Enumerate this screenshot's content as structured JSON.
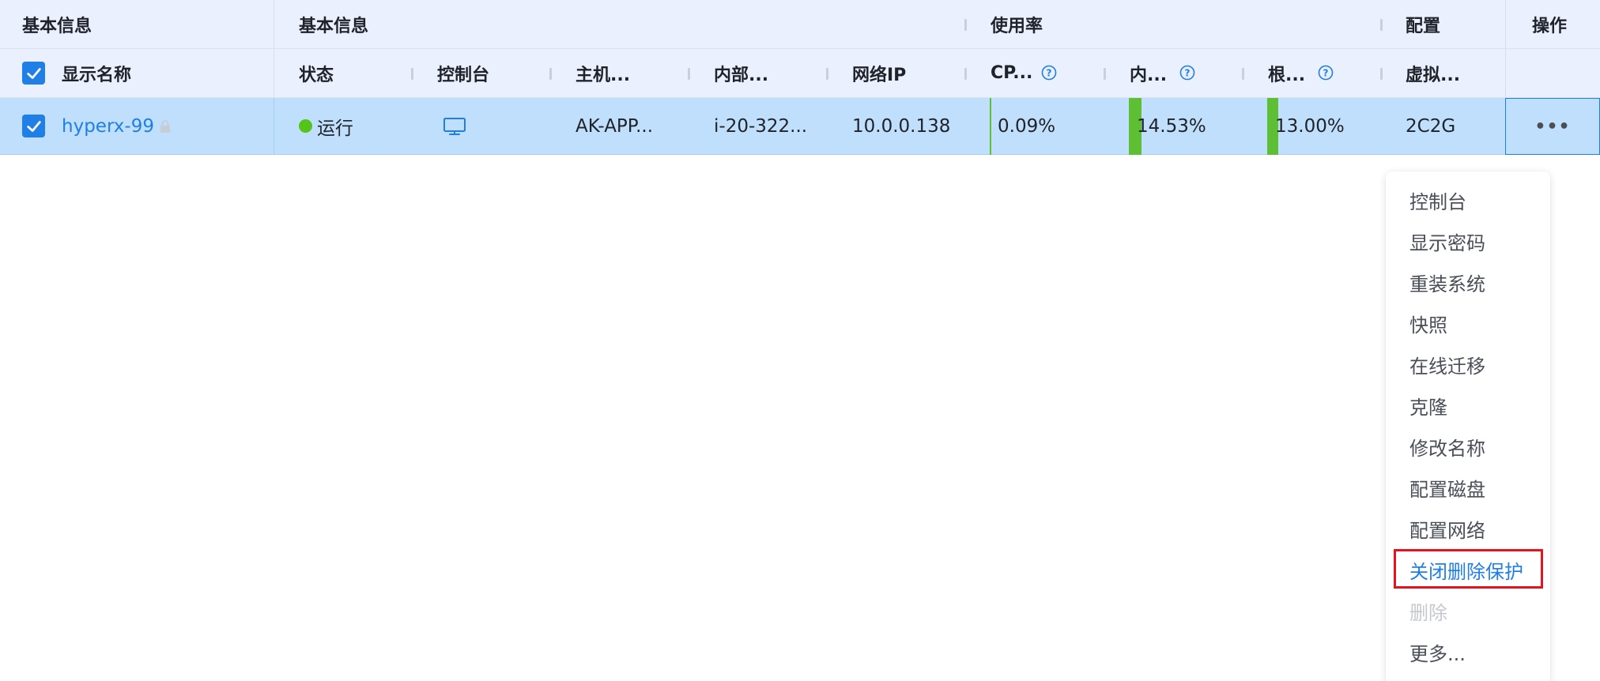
{
  "header_groups": {
    "basic_info_1": "基本信息",
    "basic_info_2": "基本信息",
    "usage": "使用率",
    "config": "配置",
    "operations": "操作"
  },
  "columns": {
    "display_name": "显示名称",
    "status": "状态",
    "console": "控制台",
    "host": "主机...",
    "internal": "内部...",
    "network_ip": "网络IP",
    "cpu": "CP...",
    "memory": "内...",
    "root": "根...",
    "virtual": "虚拟..."
  },
  "row": {
    "name": "hyperx-99",
    "status": "运行",
    "host": "AK-APP...",
    "internal": "i-20-322...",
    "ip": "10.0.0.138",
    "cpu": "0.09%",
    "memory": "14.53%",
    "root": "13.00%",
    "config": "2C2G",
    "more": "•••"
  },
  "usage_values": {
    "cpu": 0.09,
    "memory": 14.53,
    "root": 13.0
  },
  "colors": {
    "header_bg": "#eaf0fd",
    "row_selected_bg": "#bfdffc",
    "primary": "#1f7fe6",
    "success": "#52c41a",
    "usage_bar": "#5fbf34",
    "highlight": "#e5131d"
  },
  "dropdown_menu": [
    {
      "label": "控制台",
      "state": "normal"
    },
    {
      "label": "显示密码",
      "state": "normal"
    },
    {
      "label": "重装系统",
      "state": "normal"
    },
    {
      "label": "快照",
      "state": "normal"
    },
    {
      "label": "在线迁移",
      "state": "normal"
    },
    {
      "label": "克隆",
      "state": "normal"
    },
    {
      "label": "修改名称",
      "state": "normal"
    },
    {
      "label": "配置磁盘",
      "state": "normal"
    },
    {
      "label": "配置网络",
      "state": "normal"
    },
    {
      "label": "关闭删除保护",
      "state": "highlighted"
    },
    {
      "label": "删除",
      "state": "disabled"
    },
    {
      "label": "更多...",
      "state": "normal"
    }
  ],
  "icons": {
    "checkbox": "checkbox-checked-icon",
    "help": "question-circle-icon",
    "console": "monitor-icon",
    "lock": "lock-icon"
  }
}
